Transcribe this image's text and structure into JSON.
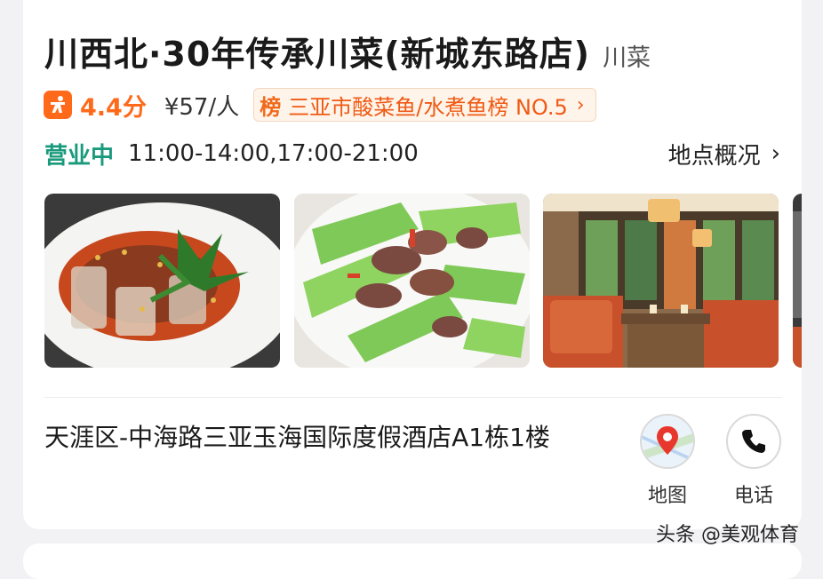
{
  "restaurant": {
    "name": "川西北·30年传承川菜(新城东路店)",
    "category": "川菜",
    "score": "4.4分",
    "price": "¥57/人",
    "rank_badge": "榜",
    "rank_text": "三亚市酸菜鱼/水煮鱼榜 NO.5",
    "status": "营业中",
    "hours": "11:00-14:00,17:00-21:00",
    "overview_label": "地点概况",
    "address": "天涯区-中海路三亚玉海国际度假酒店A1栋1楼"
  },
  "actions": {
    "map_label": "地图",
    "phone_label": "电话"
  },
  "watermark": "头条 @美观体育",
  "colors": {
    "accent_orange": "#ff6a1a",
    "open_green": "#1a9a7c"
  },
  "icons": [
    "rating-person-icon",
    "chevron-right-icon",
    "map-pin-icon",
    "phone-icon"
  ]
}
